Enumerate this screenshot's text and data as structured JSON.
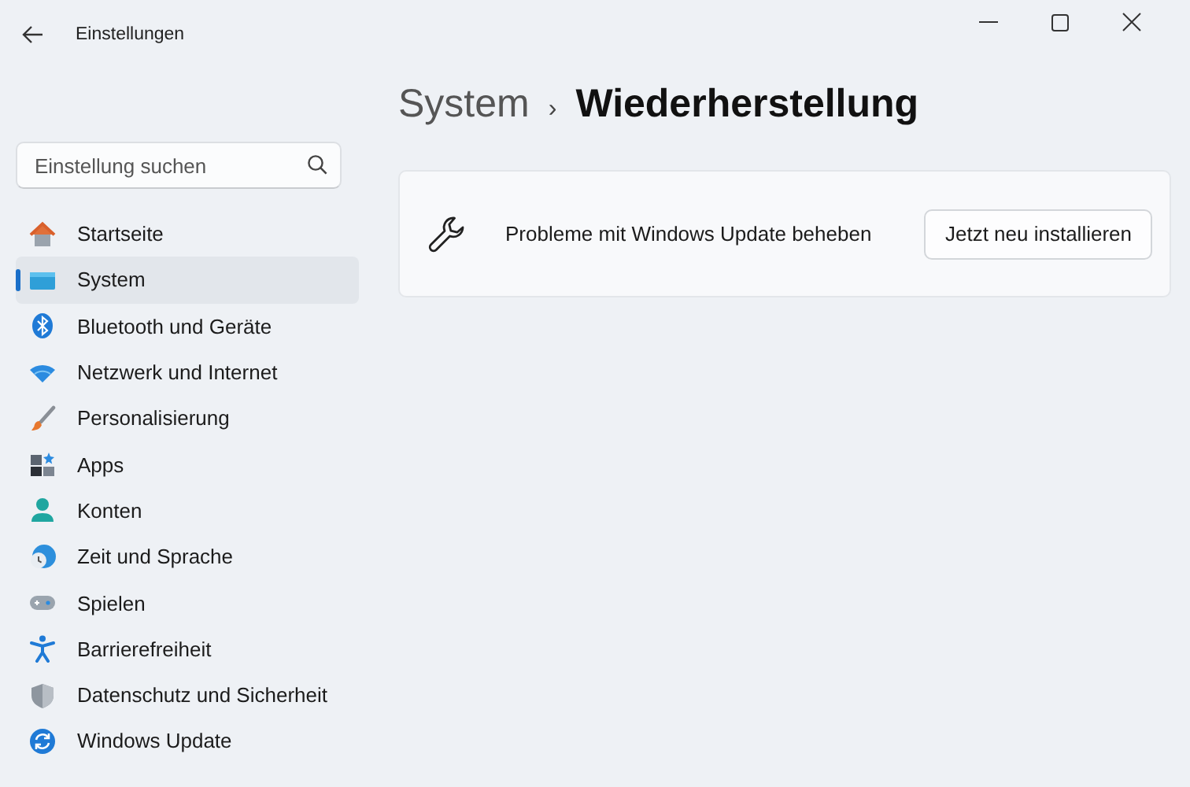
{
  "window": {
    "title": "Einstellungen"
  },
  "search": {
    "placeholder": "Einstellung suchen"
  },
  "sidebar": {
    "items": [
      {
        "label": "Startseite",
        "selected": false
      },
      {
        "label": "System",
        "selected": true
      },
      {
        "label": "Bluetooth und Geräte",
        "selected": false
      },
      {
        "label": "Netzwerk und Internet",
        "selected": false
      },
      {
        "label": "Personalisierung",
        "selected": false
      },
      {
        "label": "Apps",
        "selected": false
      },
      {
        "label": "Konten",
        "selected": false
      },
      {
        "label": "Zeit und Sprache",
        "selected": false
      },
      {
        "label": "Spielen",
        "selected": false
      },
      {
        "label": "Barrierefreiheit",
        "selected": false
      },
      {
        "label": "Datenschutz und Sicherheit",
        "selected": false
      },
      {
        "label": "Windows Update",
        "selected": false
      }
    ]
  },
  "breadcrumb": {
    "parent": "System",
    "separator": "›",
    "current": "Wiederherstellung"
  },
  "card": {
    "label": "Probleme mit Windows Update beheben",
    "button": "Jetzt neu installieren"
  }
}
